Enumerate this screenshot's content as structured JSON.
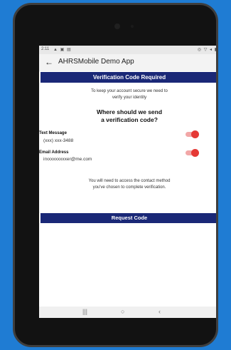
{
  "status_bar": {
    "time": "2:11",
    "left_icons": "▲ ▣ ▤",
    "right_icons": "◎ ▽ ◂ ▮"
  },
  "app_bar": {
    "back_icon": "arrow-left-icon",
    "title": "AHRSMobile Demo App"
  },
  "banner": {
    "title": "Verification Code Required"
  },
  "intro": {
    "line1": "To keep your account secure we need to",
    "line2": "verify your identity"
  },
  "question": {
    "line1": "Where should we send",
    "line2": "a verification code?"
  },
  "options": [
    {
      "title": "Text Message",
      "value": "(xxx) xxx-3488",
      "enabled": true
    },
    {
      "title": "Email Address",
      "value": "irxxxxxxxxxer@me.com",
      "enabled": true
    }
  ],
  "note": {
    "line1": "You will need to access the contact method",
    "line2": "you've chosen to complete verification."
  },
  "actions": {
    "request_code": "Request Code"
  },
  "nav": {
    "recents": "|||",
    "home": "○",
    "back": "‹"
  },
  "colors": {
    "brand": "#1a2877",
    "toggle_accent": "#e53935",
    "outer_background": "#1f7cd3"
  }
}
